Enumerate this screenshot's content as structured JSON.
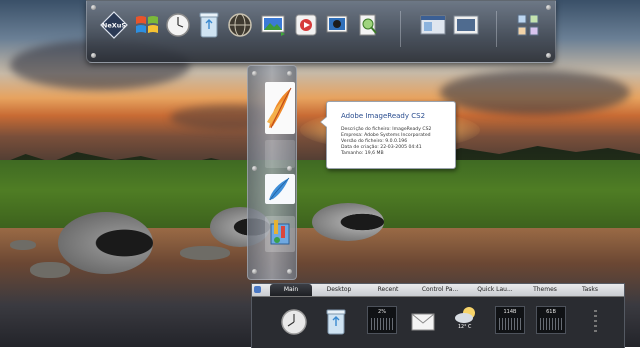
{
  "dock": {
    "icons": [
      {
        "name": "nexus-logo-icon",
        "label": "NeXuS"
      },
      {
        "name": "windows-start-icon"
      },
      {
        "name": "clock-icon"
      },
      {
        "name": "recycle-bin-icon"
      },
      {
        "name": "globe-icon"
      },
      {
        "name": "photo-viewer-icon"
      },
      {
        "name": "media-player-icon"
      },
      {
        "name": "image-editor-icon"
      },
      {
        "name": "file-search-icon"
      },
      {
        "name": "window-manager-icon"
      },
      {
        "name": "screenshot-icon"
      },
      {
        "name": "settings-icon"
      }
    ]
  },
  "tooltip": {
    "title": "Adobe ImageReady CS2",
    "lines": [
      "Descrição do ficheiro: ImageReady CS2",
      "Empresa: Adobe Systems Incorporated",
      "Versão do ficheiro: 9.0.0.196",
      "Data de criação: 22-03-2005 04:41",
      "Tamanho: 19,6 MB"
    ]
  },
  "stack": {
    "items": [
      {
        "name": "imageready-feather-icon"
      },
      {
        "name": "photoshop-feather-icon"
      },
      {
        "name": "paint-tools-icon"
      }
    ]
  },
  "tabdock": {
    "tabs": [
      "Main",
      "Desktop",
      "Recent",
      "Control Pa...",
      "Quick Lau...",
      "Themes",
      "Tasks"
    ],
    "active_tab": "Main",
    "tiles": {
      "clock": "clock-icon",
      "bin": "recycle-bin-icon",
      "cpu_value": "2%",
      "mail": "mail-icon",
      "weather_temp": "12° C",
      "mem1_value": "114B",
      "mem2_value": "61B"
    }
  },
  "colors": {
    "tooltip_title": "#2a4d8f",
    "active_tab_bg": "#1e2024",
    "dock_bg": "#5a606c"
  }
}
